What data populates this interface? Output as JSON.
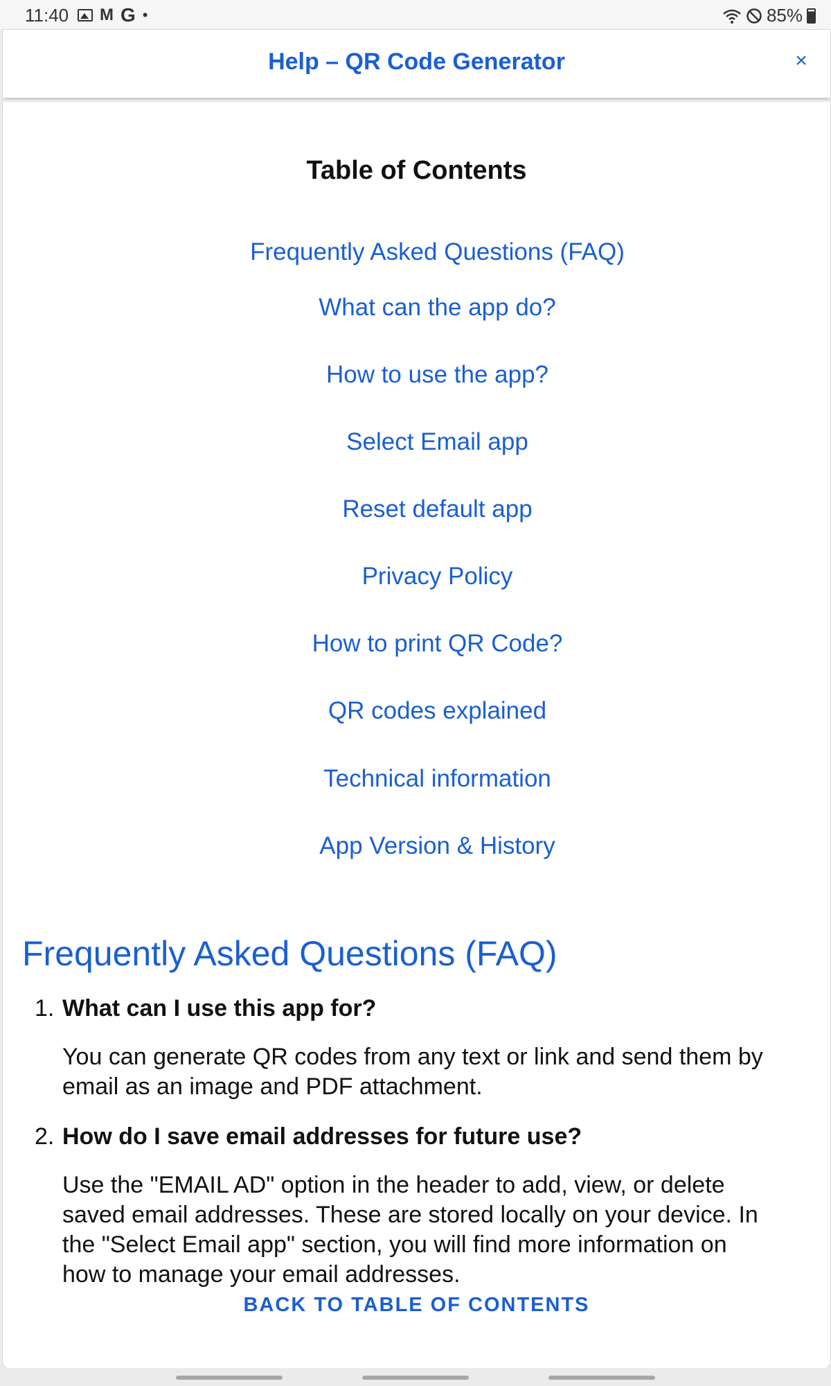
{
  "status_bar": {
    "time": "11:40",
    "left_icons": [
      "gallery-icon",
      "gmail-icon",
      "google-icon",
      "notification-dot-icon"
    ],
    "battery": "85%"
  },
  "header": {
    "title": "Help – QR Code Generator",
    "close_label": "×"
  },
  "toc": {
    "title": "Table of Contents",
    "items": [
      "Frequently Asked Questions (FAQ)",
      "What can the app do?",
      "How to use the app?",
      "Select Email app",
      "Reset default app",
      "Privacy Policy",
      "How to print QR Code?",
      "QR codes explained",
      "Technical information",
      "App Version & History"
    ]
  },
  "faq": {
    "heading": "Frequently Asked Questions (FAQ)",
    "items": [
      {
        "number": "1.",
        "question": "What can I use this app for?",
        "answer_lines": [
          "You can generate QR codes from any text or link and send them by",
          "email as an image and PDF attachment."
        ]
      },
      {
        "number": "2.",
        "question": "How do I save email addresses for future use?",
        "answer_lines": [
          "Use the \"EMAIL AD\" option in the header to add, view, or delete",
          "saved email addresses. These are stored locally on your device. In",
          "the \"Select Email app\" section, you will find more information on",
          "how to manage your email addresses."
        ]
      }
    ],
    "back_link": "BACK TO TABLE OF CONTENTS"
  },
  "colors": {
    "accent": "#1a5fd1",
    "text": "#111111",
    "background": "#ffffff"
  }
}
